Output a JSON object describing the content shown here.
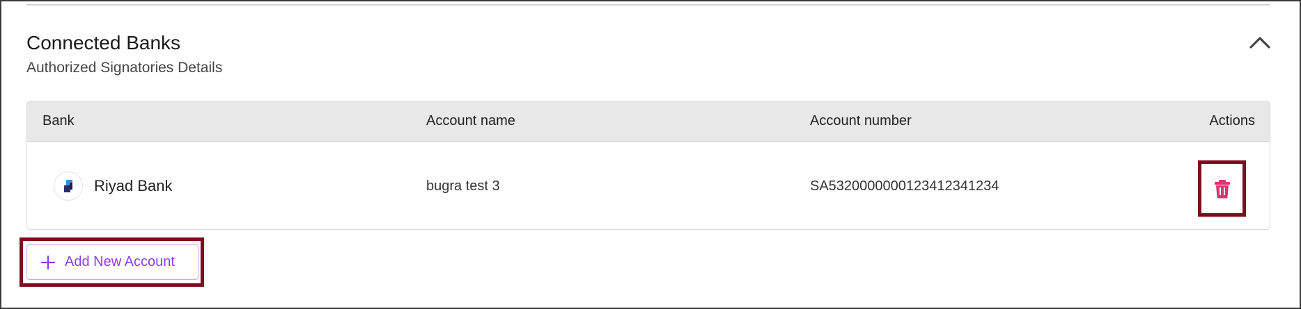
{
  "section": {
    "title": "Connected Banks",
    "subtitle": "Authorized Signatories Details"
  },
  "table": {
    "headers": {
      "bank": "Bank",
      "account_name": "Account name",
      "account_number": "Account number",
      "actions": "Actions"
    },
    "rows": [
      {
        "bank": "Riyad Bank",
        "account_name": "bugra test 3",
        "account_number": "SA5320000000123412341234"
      }
    ]
  },
  "add_button": {
    "label": "Add New Account"
  },
  "icons": {
    "collapse": "chevron-up-icon",
    "delete": "trash-icon",
    "add": "plus-icon",
    "bank_logo": "riyad-bank-logo"
  },
  "colors": {
    "accent": "#8b3ee6",
    "delete": "#e0336f",
    "highlight": "#7d0d1e",
    "header_bg": "#e8e8e8"
  }
}
